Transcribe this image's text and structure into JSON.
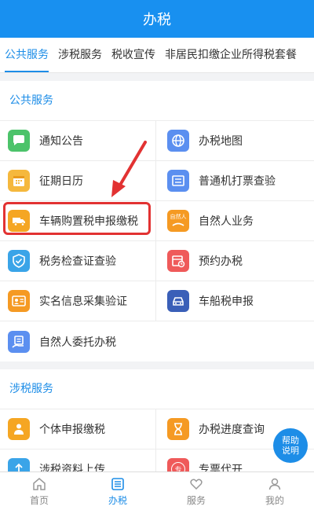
{
  "header": {
    "title": "办税"
  },
  "tabs": [
    {
      "label": "公共服务"
    },
    {
      "label": "涉税服务"
    },
    {
      "label": "税收宣传"
    },
    {
      "label": "非居民扣缴企业所得税套餐"
    }
  ],
  "public_services": {
    "title": "公共服务",
    "items": [
      {
        "label": "通知公告",
        "icon": "chat-bubble-icon",
        "color": "#4cc36a"
      },
      {
        "label": "办税地图",
        "icon": "globe-icon",
        "color": "#5b8ff0"
      },
      {
        "label": "征期日历",
        "icon": "calendar-icon",
        "color": "#f5b83d"
      },
      {
        "label": "普通机打票查验",
        "icon": "invoice-icon",
        "color": "#5b8ff0"
      },
      {
        "label": "车辆购置税申报缴税",
        "icon": "truck-icon",
        "color": "#f5a623"
      },
      {
        "label": "自然人业务",
        "icon": "person-card-icon",
        "color": "#f59a23",
        "badge": "自然人"
      },
      {
        "label": "税务检查证查验",
        "icon": "shield-check-icon",
        "color": "#3aa4e8"
      },
      {
        "label": "预约办税",
        "icon": "appointment-icon",
        "color": "#ef5a5a"
      },
      {
        "label": "实名信息采集验证",
        "icon": "id-card-icon",
        "color": "#f59a23"
      },
      {
        "label": "车船税申报",
        "icon": "car-icon",
        "color": "#3a5fb8"
      },
      {
        "label": "自然人委托办税",
        "icon": "entrust-icon",
        "color": "#5b8ff0"
      }
    ]
  },
  "tax_services": {
    "title": "涉税服务",
    "items": [
      {
        "label": "个体申报缴税",
        "icon": "person-icon",
        "color": "#f5a623"
      },
      {
        "label": "办税进度查询",
        "icon": "hourglass-icon",
        "color": "#f59a23"
      },
      {
        "label": "涉税资料上传",
        "icon": "upload-icon",
        "color": "#3aa4e8"
      },
      {
        "label": "专票代开",
        "icon": "special-invoice-icon",
        "color": "#ef5a5a",
        "badge": "专"
      }
    ]
  },
  "help_button": {
    "line1": "帮助",
    "line2": "说明"
  },
  "bottom_nav": [
    {
      "label": "首页",
      "icon": "home-icon"
    },
    {
      "label": "办税",
      "icon": "list-icon",
      "active": true
    },
    {
      "label": "服务",
      "icon": "heart-icon"
    },
    {
      "label": "我的",
      "icon": "user-icon"
    }
  ]
}
